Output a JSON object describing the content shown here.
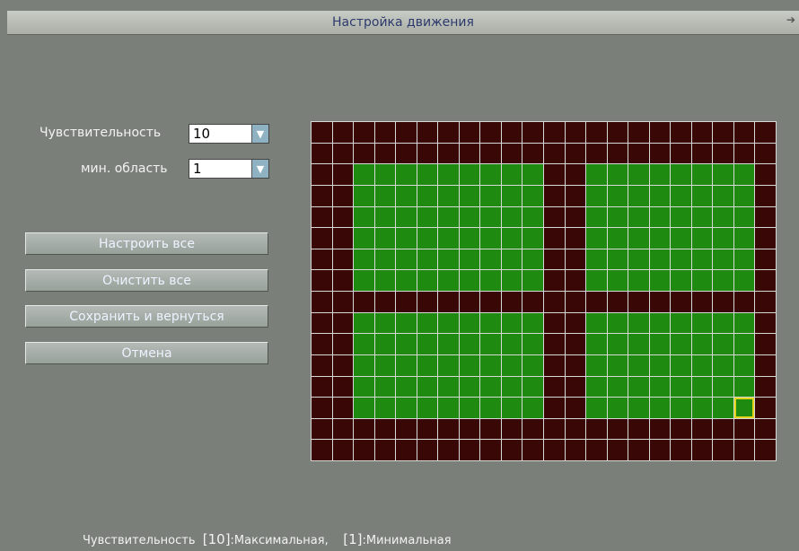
{
  "window": {
    "title": "Настройка движения"
  },
  "sensitivity": {
    "label": "Чувствительность",
    "value": "10"
  },
  "min_area": {
    "label": "мин. область",
    "value": "1"
  },
  "buttons": {
    "set_all": "Настроить все",
    "clear_all": "Очистить все",
    "save_return": "Сохранить и вернуться",
    "cancel": "Отмена"
  },
  "grid": {
    "cols": 22,
    "rows": 16,
    "active_blocks": [
      {
        "row_from": 2,
        "row_to": 7,
        "col_from": 2,
        "col_to": 10
      },
      {
        "row_from": 2,
        "row_to": 7,
        "col_from": 13,
        "col_to": 20
      },
      {
        "row_from": 9,
        "row_to": 13,
        "col_from": 2,
        "col_to": 10
      },
      {
        "row_from": 9,
        "row_to": 13,
        "col_from": 13,
        "col_to": 20
      }
    ],
    "selected_cell": {
      "row": 13,
      "col": 20
    },
    "colors": {
      "active": "#1f8a10",
      "inactive": "#3a0707",
      "selected": "#e2d21a"
    }
  },
  "hint": {
    "prefix": "Чувствительность  ",
    "max_key": "[10]",
    "max_text": ":Максимальная,",
    "min_key": "[1]",
    "min_text": ":Минимальная"
  }
}
